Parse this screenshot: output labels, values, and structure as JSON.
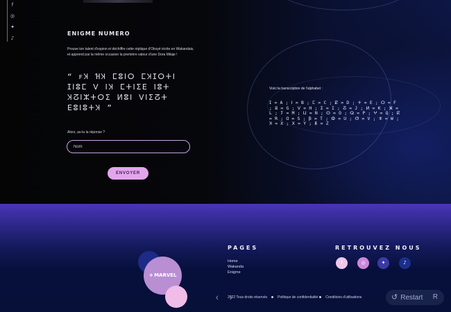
{
  "social": {
    "icons": [
      "facebook-icon",
      "instagram-icon",
      "twitter-icon",
      "tiktok-icon"
    ],
    "glyphs": [
      "f",
      "◎",
      "✦",
      "♪"
    ]
  },
  "enigma": {
    "title": "ENIGME NUMERO",
    "intro": "Prouve ton talent d'espion et déchiffre cette réplique d'Okoyé écrite en Wakandais, et apprend par la même occasion la première valeur d'une Dora Milaje !",
    "cipher": "“ ꜰꞰ ꞪꞰ ⵎⵓⵏⵔ ⵎꞰⵊⵔⵜⵏ ⵊⵏⵓⵎ ⴸ ⵏꞰ ⵎⵜⵏⵉⴹ ⵏⵓⵜ Ʞⵒⵏⵣⵜⵔⵉ ⵍⵓⵏ ⴸⵏⵉⵒⵜ ⴹⵓⵏⵓⵜꞰ ”",
    "answer_label": "Alors, as-tu la réponse ?",
    "input_placeholder": "Nom",
    "submit_label": "ENVOYER"
  },
  "alphabet": {
    "label": "Voici la transcription de l'alphabet :",
    "map": "ⵊ = A ; ⵏ = B ; ⵎ = C ; ⵇ = D ; ⵜ = E ; ⵔ = F ; ⵓ = G ; ⴸ = H ; ⵉ = I ; ⵒ = J ; ⵍ = K ; ⵣ = L ; ⵢ = M ; ⵡ = N ; ⵙ = O ; ⵕ = P ; ⵖ = Q ; ⴽ = R ; Ɑ = S ; Ꞵ = T ; ⵀ = U ; ⵚ = V ; ⵐ = W ; Ʞ = X ; ⵝ = Y ; ⵟ = Z"
  },
  "footer": {
    "logo_text": "MARVEL",
    "logo_mark": "⟡",
    "pages_title": "PAGES",
    "pages_links": [
      "Home",
      "Wakanda",
      "Enigme"
    ],
    "retrouvez_title": "RETROUVEZ NOUS",
    "social_icons": [
      "facebook-icon",
      "instagram-icon",
      "twitter-icon",
      "tiktok-icon"
    ],
    "social_glyphs": [
      "f",
      "◎",
      "✦",
      "♪"
    ],
    "legal": [
      "2022 Tous droits réservés",
      "Politique de confidentialité",
      "Conditions d'utilisations"
    ],
    "prev_label": "‹",
    "next_label": "›",
    "restart_label": "Restart",
    "restart_symbol": "↺",
    "restart_key": "R"
  }
}
